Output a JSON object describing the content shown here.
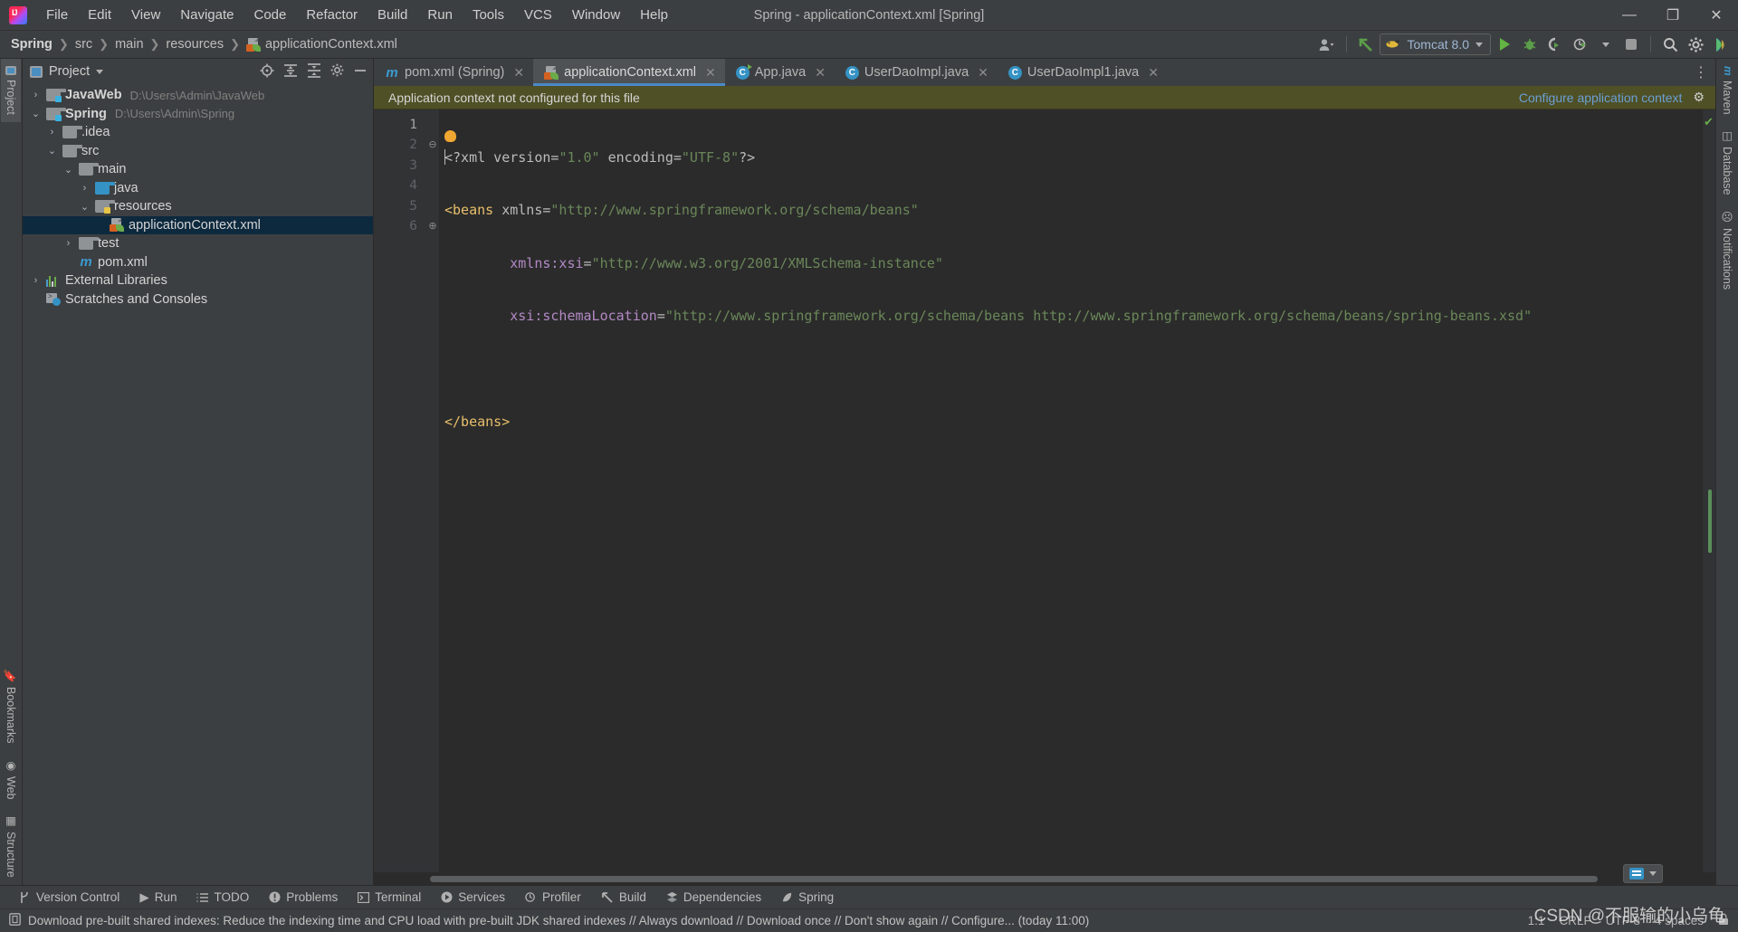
{
  "window": {
    "title": "Spring - applicationContext.xml [Spring]",
    "minimize": "—",
    "maximize": "❐",
    "close": "✕"
  },
  "menu": [
    {
      "label": "File"
    },
    {
      "label": "Edit"
    },
    {
      "label": "View"
    },
    {
      "label": "Navigate"
    },
    {
      "label": "Code"
    },
    {
      "label": "Refactor"
    },
    {
      "label": "Build"
    },
    {
      "label": "Run"
    },
    {
      "label": "Tools"
    },
    {
      "label": "VCS"
    },
    {
      "label": "Window"
    },
    {
      "label": "Help"
    }
  ],
  "breadcrumbs": [
    {
      "label": "Spring"
    },
    {
      "label": "src"
    },
    {
      "label": "main"
    },
    {
      "label": "resources"
    },
    {
      "label": "applicationContext.xml"
    }
  ],
  "toolbar": {
    "account_icon": "user-icon",
    "update_icon": "update-project-arrow-icon",
    "run_config": "Tomcat 8.0",
    "run": "run-icon",
    "debug": "debug-icon",
    "run_coverage": "run-with-coverage-icon",
    "profiler": "profiler-icon",
    "stop": "stop-icon",
    "search": "search-everywhere-icon",
    "settings": "settings-gear-icon",
    "assistant": "ai-assistant-icon"
  },
  "left_stripe": [
    {
      "label": "Project",
      "active": true
    },
    {
      "label": "Bookmarks",
      "active": false
    },
    {
      "label": "Web",
      "active": false
    },
    {
      "label": "Structure",
      "active": false
    }
  ],
  "right_stripe": [
    {
      "label": "m",
      "active": false
    },
    {
      "label": "Maven",
      "active": false
    },
    {
      "label": "Database",
      "active": false
    },
    {
      "label": "Notifications",
      "active": false
    }
  ],
  "project_panel": {
    "title": "Project",
    "tools": [
      "select-opened-file-icon",
      "expand-all-icon",
      "collapse-all-icon",
      "panel-settings-icon",
      "hide-panel-icon"
    ],
    "tree": [
      {
        "label": "JavaWeb",
        "path": "D:\\Users\\Admin\\JavaWeb",
        "arrow": "›",
        "indent": 0,
        "icon": "module-folder",
        "bold": true,
        "selected": false
      },
      {
        "label": "Spring",
        "path": "D:\\Users\\Admin\\Spring",
        "arrow": "⌄",
        "indent": 0,
        "icon": "module-folder",
        "bold": true,
        "selected": false
      },
      {
        "label": ".idea",
        "path": "",
        "arrow": "›",
        "indent": 1,
        "icon": "folder",
        "bold": false,
        "selected": false
      },
      {
        "label": "src",
        "path": "",
        "arrow": "⌄",
        "indent": 1,
        "icon": "folder",
        "bold": false,
        "selected": false
      },
      {
        "label": "main",
        "path": "",
        "arrow": "⌄",
        "indent": 2,
        "icon": "folder",
        "bold": false,
        "selected": false
      },
      {
        "label": "java",
        "path": "",
        "arrow": "›",
        "indent": 3,
        "icon": "source-folder",
        "bold": false,
        "selected": false
      },
      {
        "label": "resources",
        "path": "",
        "arrow": "⌄",
        "indent": 3,
        "icon": "resource-folder",
        "bold": false,
        "selected": false
      },
      {
        "label": "applicationContext.xml",
        "path": "",
        "arrow": "",
        "indent": 4,
        "icon": "spring-xml",
        "bold": false,
        "selected": true
      },
      {
        "label": "test",
        "path": "",
        "arrow": "›",
        "indent": 2,
        "icon": "folder",
        "bold": false,
        "selected": false
      },
      {
        "label": "pom.xml",
        "path": "",
        "arrow": "",
        "indent": 2,
        "icon": "maven",
        "bold": false,
        "selected": false
      },
      {
        "label": "External Libraries",
        "path": "",
        "arrow": "›",
        "indent": 0,
        "icon": "libraries",
        "bold": false,
        "selected": false
      },
      {
        "label": "Scratches and Consoles",
        "path": "",
        "arrow": "",
        "indent": 0,
        "icon": "scratches",
        "bold": false,
        "selected": false
      }
    ]
  },
  "editor_tabs": [
    {
      "label": "pom.xml (Spring)",
      "icon": "maven-icon",
      "active": false,
      "close": "✕"
    },
    {
      "label": "applicationContext.xml",
      "icon": "spring-xml-icon",
      "active": true,
      "close": "✕"
    },
    {
      "label": "App.java",
      "icon": "java-class-run-icon",
      "active": false,
      "close": "✕"
    },
    {
      "label": "UserDaoImpl.java",
      "icon": "java-class-icon",
      "active": false,
      "close": "✕"
    },
    {
      "label": "UserDaoImpl1.java",
      "icon": "java-class-icon",
      "active": false,
      "close": "✕"
    }
  ],
  "tabs_overflow_icon": "⋮",
  "banner": {
    "message": "Application context not configured for this file",
    "link": "Configure application context",
    "gear": "⚙"
  },
  "code": {
    "lines": [
      "1",
      "2",
      "3",
      "4",
      "5",
      "6"
    ],
    "line1_a": "<?xml version=",
    "line1_b": "\"1.0\"",
    "line1_c": " encoding=",
    "line1_d": "\"UTF-8\"",
    "line1_e": "?>",
    "line2_tag": "<beans",
    "line2_attr": " xmlns=",
    "line2_val": "\"http://www.springframework.org/schema/beans\"",
    "line3_ns": "xmlns:xsi",
    "line3_eq": "=",
    "line3_val": "\"http://www.w3.org/2001/XMLSchema-instance\"",
    "line4_ns": "xsi:schemaLocation",
    "line4_eq": "=",
    "line4_val": "\"http://www.springframework.org/schema/beans http://www.springframework.org/schema/beans/spring-beans.xsd\"",
    "line6": "</beans>",
    "fold2": "⊖",
    "fold6": "⊕",
    "inspection_ok": "✔"
  },
  "bottom_tools": [
    {
      "label": "Version Control",
      "icon": "branch-icon"
    },
    {
      "label": "Run",
      "icon": "run-icon"
    },
    {
      "label": "TODO",
      "icon": "todo-icon"
    },
    {
      "label": "Problems",
      "icon": "problems-icon"
    },
    {
      "label": "Terminal",
      "icon": "terminal-icon"
    },
    {
      "label": "Services",
      "icon": "services-icon"
    },
    {
      "label": "Profiler",
      "icon": "profiler-icon"
    },
    {
      "label": "Build",
      "icon": "build-hammer-icon"
    },
    {
      "label": "Dependencies",
      "icon": "dependencies-icon"
    },
    {
      "label": "Spring",
      "icon": "spring-leaf-icon"
    }
  ],
  "status": {
    "message": "Download pre-built shared indexes: Reduce the indexing time and CPU load with pre-built JDK shared indexes // Always download // Download once // Don't show again // Configure... (today 11:00)",
    "message_icon": "notification-icon",
    "caret": "1:1",
    "line_sep": "CRLF",
    "encoding": "UTF-8",
    "indent": "4 spaces",
    "lock_icon": "🔒"
  },
  "watermark": "CSDN @不服输的小乌龟"
}
